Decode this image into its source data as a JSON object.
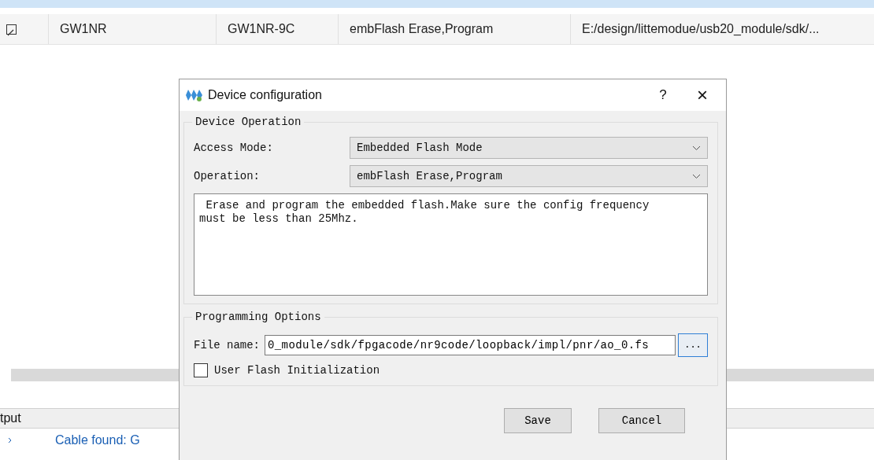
{
  "device_table": {
    "row": {
      "checked": true,
      "family": "GW1NR",
      "device": "GW1NR-9C",
      "operation": "embFlash Erase,Program",
      "file": "E:/design/littemodue/usb20_module/sdk/..."
    }
  },
  "output_panel": {
    "title": "tput",
    "lines": [
      "Cable found: G"
    ]
  },
  "dialog": {
    "title": "Device configuration",
    "help": "?",
    "close": "×",
    "device_operation": {
      "title": "Device Operation",
      "access_mode_label": "Access Mode:",
      "access_mode": "Embedded Flash Mode",
      "operation_label": "Operation:",
      "operation": "embFlash Erase,Program",
      "description": "Erase and program the embedded flash.Make sure the config frequency must be less than 25Mhz."
    },
    "programming_options": {
      "title": "Programming Options",
      "file_name_label": "File name:",
      "file_name": "0_module/sdk/fpgacode/nr9code/loopback/impl/pnr/ao_0.fs",
      "browse": "...",
      "user_flash_init": {
        "label": "User Flash Initialization",
        "checked": false
      }
    },
    "buttons": [
      "Save",
      "Cancel"
    ]
  }
}
